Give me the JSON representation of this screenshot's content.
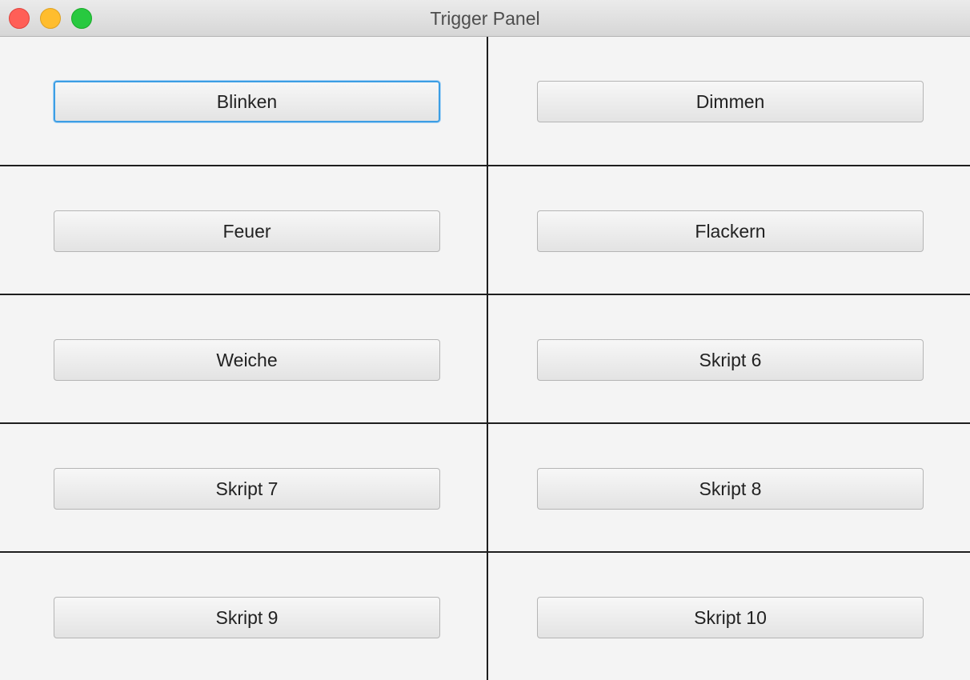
{
  "window": {
    "title": "Trigger Panel"
  },
  "buttons": [
    {
      "label": "Blinken"
    },
    {
      "label": "Dimmen"
    },
    {
      "label": "Feuer"
    },
    {
      "label": "Flackern"
    },
    {
      "label": "Weiche"
    },
    {
      "label": "Skript 6"
    },
    {
      "label": "Skript 7"
    },
    {
      "label": "Skript 8"
    },
    {
      "label": "Skript 9"
    },
    {
      "label": "Skript 10"
    }
  ],
  "colors": {
    "close": "#ff5f57",
    "minimize": "#ffbd2e",
    "zoom": "#28c940",
    "focus_ring": "#3c9ee4"
  }
}
